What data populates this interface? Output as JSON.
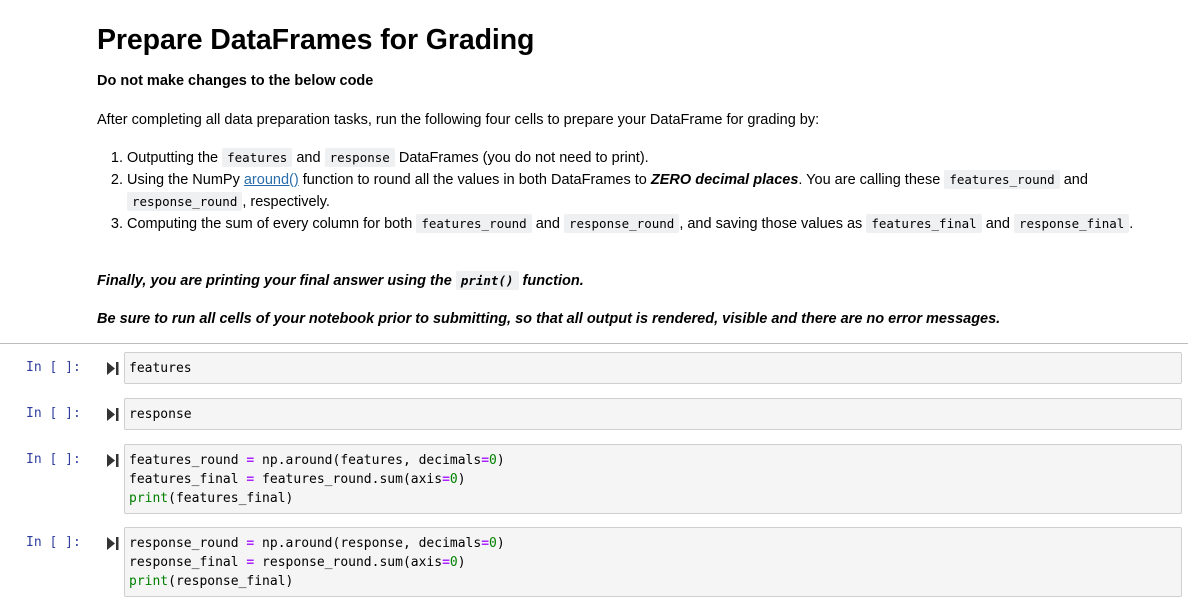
{
  "markdown": {
    "title": "Prepare DataFrames for Grading",
    "subtitle": "Do not make changes to the below code",
    "intro": "After completing all data preparation tasks, run the following four cells to prepare your DataFrame for grading by:",
    "steps": {
      "s1": {
        "t1": "Outputting the ",
        "c1": "features",
        "t2": " and ",
        "c2": "response",
        "t3": " DataFrames (you do not need to print)."
      },
      "s2": {
        "t1": "Using the NumPy ",
        "link": "around()",
        "t2": " function to round all the values in both DataFrames to ",
        "em": "ZERO decimal places",
        "t3": ". You are calling these ",
        "c1": "features_round",
        "t4": " and ",
        "c2": "response_round",
        "t5": ", respectively."
      },
      "s3": {
        "t1": "Computing the sum of every column for both ",
        "c1": "features_round",
        "t2": " and ",
        "c2": "response_round",
        "t3": ", and saving those values as ",
        "c3": "features_final",
        "t4": " and ",
        "c4": "response_final",
        "t5": "."
      }
    },
    "finally": {
      "t1": "Finally, you are printing your final answer using the ",
      "code": "print()",
      "t2": " function."
    },
    "be_sure": "Be sure to run all cells of your notebook prior to submitting, so that all output is rendered, visible and there are no error messages."
  },
  "cells": [
    {
      "prompt": "In [ ]:",
      "lines": [
        "features"
      ]
    },
    {
      "prompt": "In [ ]:",
      "lines": [
        "response"
      ]
    },
    {
      "prompt": "In [ ]:",
      "code": {
        "l1a": "features_round ",
        "l1op": "=",
        "l1b": " np.around(features, decimals",
        "l1op2": "=",
        "l1n": "0",
        "l1c": ")",
        "l2a": "features_final ",
        "l2op": "=",
        "l2b": " features_round.sum(axis",
        "l2op2": "=",
        "l2n": "0",
        "l2c": ")",
        "l3fn": "print",
        "l3b": "(features_final)"
      }
    },
    {
      "prompt": "In [ ]:",
      "code": {
        "l1a": "response_round ",
        "l1op": "=",
        "l1b": " np.around(response, decimals",
        "l1op2": "=",
        "l1n": "0",
        "l1c": ")",
        "l2a": "response_final ",
        "l2op": "=",
        "l2b": " response_round.sum(axis",
        "l2op2": "=",
        "l2n": "0",
        "l2c": ")",
        "l3fn": "print",
        "l3b": "(response_final)"
      }
    }
  ]
}
